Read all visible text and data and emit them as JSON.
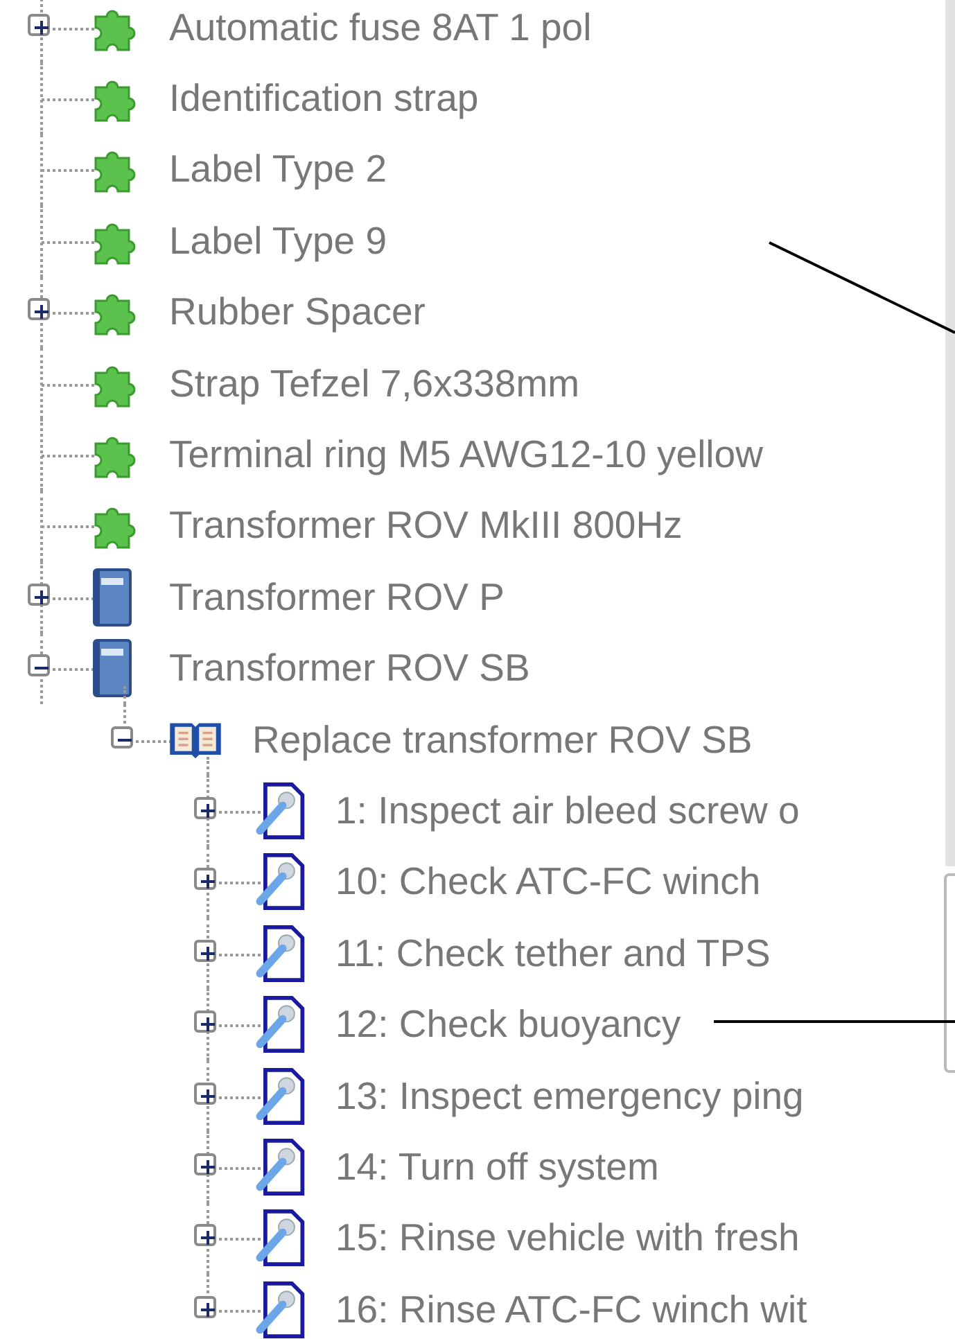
{
  "tree": [
    {
      "label": "Automatic fuse 8AT 1 pol",
      "kind": "part",
      "expanded": false
    },
    {
      "label": "Identification strap",
      "kind": "part"
    },
    {
      "label": "Label Type 2",
      "kind": "part"
    },
    {
      "label": "Label Type 9",
      "kind": "part"
    },
    {
      "label": "Rubber Spacer",
      "kind": "part",
      "expanded": false
    },
    {
      "label": "Strap Tefzel 7,6x338mm",
      "kind": "part"
    },
    {
      "label": "Terminal ring M5 AWG12-10 yellow",
      "kind": "part"
    },
    {
      "label": "Transformer ROV MkIII 800Hz",
      "kind": "part"
    },
    {
      "label": "Transformer ROV P",
      "kind": "manual",
      "expanded": false
    },
    {
      "label": "Transformer ROV SB",
      "kind": "manual",
      "expanded": true,
      "children": [
        {
          "label": "Replace transformer ROV SB",
          "kind": "book",
          "expanded": true,
          "children": [
            {
              "label": "1: Inspect air bleed screw o",
              "kind": "task",
              "expanded": false
            },
            {
              "label": "10: Check ATC-FC winch",
              "kind": "task",
              "expanded": false
            },
            {
              "label": "11: Check tether and TPS",
              "kind": "task",
              "expanded": false
            },
            {
              "label": "12: Check buoyancy",
              "kind": "task",
              "expanded": false
            },
            {
              "label": "13: Inspect emergency ping",
              "kind": "task",
              "expanded": false
            },
            {
              "label": "14: Turn off system",
              "kind": "task",
              "expanded": false
            },
            {
              "label": "15: Rinse vehicle with fresh",
              "kind": "task",
              "expanded": false
            },
            {
              "label": "16: Rinse ATC-FC winch wit",
              "kind": "task",
              "expanded": false
            }
          ]
        }
      ]
    }
  ]
}
